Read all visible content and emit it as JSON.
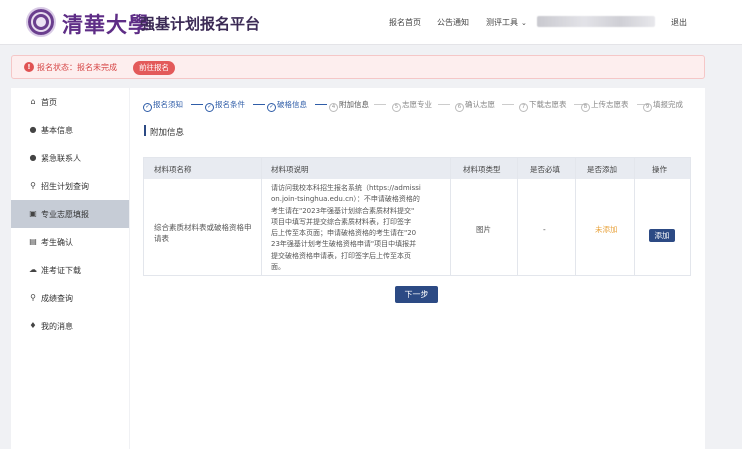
{
  "header": {
    "logo_text": "清華大學",
    "platform_title": "强基计划报名平台",
    "nav": [
      "报名首页",
      "公告通知",
      "测评工具"
    ],
    "logout": "退出"
  },
  "status": {
    "text": "报名状态：报名未完成",
    "button": "前往报名"
  },
  "sidebar": {
    "items": [
      {
        "label": "首页",
        "icon": "home-icon",
        "glyph": "⌂"
      },
      {
        "label": "基本信息",
        "icon": "user-icon",
        "glyph": "●"
      },
      {
        "label": "紧急联系人",
        "icon": "user-icon",
        "glyph": "●"
      },
      {
        "label": "招生计划查询",
        "icon": "search-icon",
        "glyph": "⚲"
      },
      {
        "label": "专业志愿填报",
        "icon": "form-icon",
        "glyph": "▣"
      },
      {
        "label": "考生确认",
        "icon": "document-icon",
        "glyph": "▤"
      },
      {
        "label": "准考证下载",
        "icon": "cloud-download-icon",
        "glyph": "☁"
      },
      {
        "label": "成绩查询",
        "icon": "search-icon",
        "glyph": "⚲"
      },
      {
        "label": "我的消息",
        "icon": "bell-icon",
        "glyph": "♦"
      }
    ]
  },
  "steps": [
    {
      "num": "✓",
      "label": "报名须知"
    },
    {
      "num": "✓",
      "label": "报名条件"
    },
    {
      "num": "✓",
      "label": "破格信息"
    },
    {
      "num": "4",
      "label": "附加信息"
    },
    {
      "num": "5",
      "label": "志愿专业"
    },
    {
      "num": "6",
      "label": "确认志愿"
    },
    {
      "num": "7",
      "label": "下载志愿表"
    },
    {
      "num": "8",
      "label": "上传志愿表"
    },
    {
      "num": "9",
      "label": "填报完成"
    }
  ],
  "section_title": "附加信息",
  "table": {
    "headers": [
      "材料项名称",
      "材料项说明",
      "材料项类型",
      "是否必填",
      "是否添加",
      "操作"
    ],
    "row": {
      "name": "综合素质材料表或破格资格申请表",
      "desc_lines": [
        "请访问我校本科招生报名系统（https://admissi",
        "on.join-tsinghua.edu.cn）：不申请破格资格的",
        "考生请在\"2023年强基计划综合素质材料提交\"",
        "项目中填写并提交综合素质材料表，打印签字",
        "后上传至本页面；申请破格资格的考生请在\"20",
        "23年强基计划考生破格资格申请\"项目中填报并",
        "提交破格资格申请表，打印签字后上传至本页",
        "面。"
      ],
      "type": "图片",
      "required": "-",
      "added": "未添加",
      "action": "添加"
    }
  },
  "next_button": "下一步",
  "colors": {
    "accent": "#2c4a84",
    "brand": "#5e2d86",
    "warning": "#d64545",
    "not_added": "#e8a33d"
  }
}
